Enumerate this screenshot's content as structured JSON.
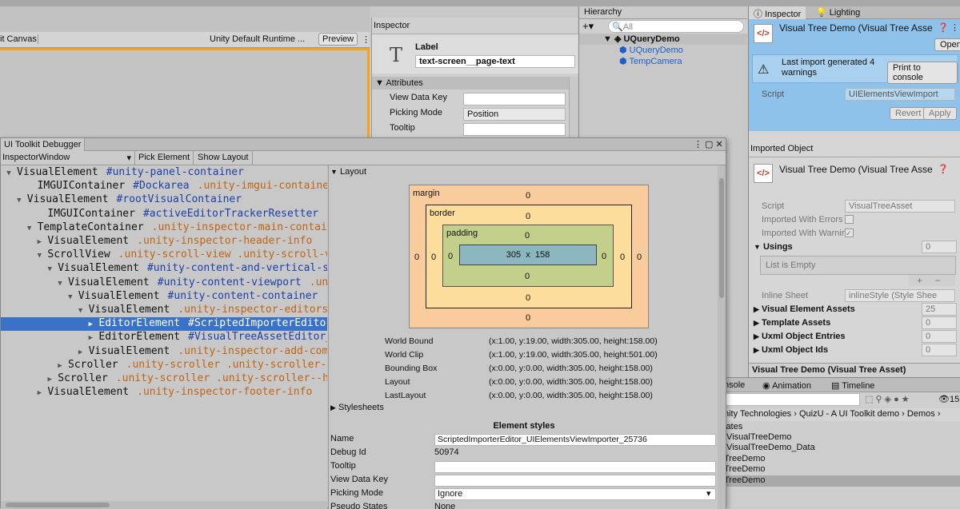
{
  "game": {
    "tab_canvas": "it Canvas",
    "runtime_select": "Unity Default Runtime ...",
    "preview_button": "Preview"
  },
  "mini_inspector": {
    "title": "Inspector",
    "label_heading": "Label",
    "label_value": "text-screen__page-text",
    "attributes_header": "Attributes",
    "rows": [
      {
        "label": "View Data Key",
        "value": ""
      },
      {
        "label": "Picking Mode",
        "value": "Position"
      },
      {
        "label": "Tooltip",
        "value": ""
      }
    ]
  },
  "hierarchy": {
    "title": "Hierarchy",
    "search_placeholder": "All",
    "root": "UQueryDemo",
    "children": [
      "UQueryDemo",
      "TempCamera"
    ]
  },
  "inspector": {
    "tab_inspector": "Inspector",
    "tab_lighting": "Lighting",
    "asset_title": "Visual Tree Demo (Visual Tree Asse",
    "open_button": "Open",
    "warning_text": "Last import generated 4 warnings",
    "print_button": "Print to console",
    "script_label": "Script",
    "script_value": "UIElementsViewImport",
    "revert_button": "Revert",
    "apply_button": "Apply",
    "imported_object": "Imported Object",
    "asset_title2": "Visual Tree Demo (Visual Tree Asse",
    "props": [
      {
        "label": "Script",
        "value": "VisualTreeAsset"
      },
      {
        "label": "Imported With Errors",
        "value": ""
      },
      {
        "label": "Imported With Warnin",
        "value": "✓"
      }
    ],
    "usings_label": "Usings",
    "usings_value": "0",
    "list_empty": "List is Empty",
    "plus": "+",
    "minus": "−",
    "inline_sheet_label": "Inline Sheet",
    "inline_sheet_value": "inlineStyle (Style Shee",
    "groups": [
      {
        "label": "Visual Element Assets",
        "value": "25"
      },
      {
        "label": "Template Assets",
        "value": "0"
      },
      {
        "label": "Uxml Object Entries",
        "value": "0"
      },
      {
        "label": "Uxml Object Ids",
        "value": "0"
      }
    ],
    "footer": "Visual Tree Demo (Visual Tree Asset)"
  },
  "console": {
    "tab_console": "nsole",
    "tab_animation": "Animation",
    "tab_timeline": "Timeline",
    "count": "15",
    "breadcrumb": [
      "nity Technologies",
      "QuizU - A UI Toolkit demo",
      "Demos"
    ],
    "items": [
      "lates",
      ".VisualTreeDemo",
      ".VisualTreeDemo_Data",
      "TreeDemo",
      "TreeDemo",
      "TreeDemo"
    ]
  },
  "debugger": {
    "title": "UI Toolkit Debugger",
    "window_select": "InspectorWindow",
    "pick_element": "Pick Element",
    "show_layout": "Show Layout",
    "tree": [
      {
        "indent": 0,
        "tri": "▼",
        "type": "VisualElement",
        "id": "#unity-panel-container",
        "cls": ""
      },
      {
        "indent": 2,
        "tri": "",
        "type": "IMGUIContainer",
        "id": "#Dockarea",
        "cls": ".unity-imgui-container"
      },
      {
        "indent": 1,
        "tri": "▼",
        "type": "VisualElement",
        "id": "#rootVisualContainer",
        "cls": ""
      },
      {
        "indent": 3,
        "tri": "",
        "type": "IMGUIContainer",
        "id": "#activeEditorTrackerResetter",
        "cls": ".uni"
      },
      {
        "indent": 2,
        "tri": "▼",
        "type": "TemplateContainer",
        "id": "",
        "cls": ".unity-inspector-main-container"
      },
      {
        "indent": 3,
        "tri": "▶",
        "type": "VisualElement",
        "id": "",
        "cls": ".unity-inspector-header-info"
      },
      {
        "indent": 3,
        "tri": "▼",
        "type": "ScrollView",
        "id": "",
        "cls": ".unity-scroll-view  .unity-scroll-vie"
      },
      {
        "indent": 4,
        "tri": "▼",
        "type": "VisualElement",
        "id": "#unity-content-and-vertical-scro",
        "cls": ""
      },
      {
        "indent": 5,
        "tri": "▼",
        "type": "VisualElement",
        "id": "#unity-content-viewport",
        "cls": ".unit"
      },
      {
        "indent": 6,
        "tri": "▼",
        "type": "VisualElement",
        "id": "#unity-content-container",
        "cls": ".u"
      },
      {
        "indent": 7,
        "tri": "▼",
        "type": "VisualElement",
        "id": "",
        "cls": ".unity-inspector-editors-li"
      },
      {
        "indent": 8,
        "tri": "▶",
        "type": "EditorElement",
        "id": "#ScriptedImporterEditor_U",
        "cls": "",
        "selected": true
      },
      {
        "indent": 8,
        "tri": "▶",
        "type": "EditorElement",
        "id": "#VisualTreeAssetEditor_Vi",
        "cls": ""
      },
      {
        "indent": 7,
        "tri": "▶",
        "type": "VisualElement",
        "id": "",
        "cls": ".unity-inspector-add-compon"
      },
      {
        "indent": 5,
        "tri": "▶",
        "type": "Scroller",
        "id": "",
        "cls": ".unity-scroller  .unity-scroller--v"
      },
      {
        "indent": 4,
        "tri": "▶",
        "type": "Scroller",
        "id": "",
        "cls": ".unity-scroller  .unity-scroller--hor"
      },
      {
        "indent": 3,
        "tri": "▶",
        "type": "VisualElement",
        "id": "",
        "cls": ".unity-inspector-footer-info"
      }
    ],
    "layout_header": "Layout",
    "box": {
      "margin_label": "margin",
      "border_label": "border",
      "padding_label": "padding",
      "zero": "0",
      "width": "305",
      "x": "x",
      "height": "158"
    },
    "bounds": [
      {
        "label": "World Bound",
        "value": "(x:1.00, y:19.00, width:305.00, height:158.00)"
      },
      {
        "label": "World Clip",
        "value": "(x:1.00, y:19.00, width:305.00, height:501.00)"
      },
      {
        "label": "Bounding Box",
        "value": "(x:0.00, y:0.00, width:305.00, height:158.00)"
      },
      {
        "label": "Layout",
        "value": "(x:0.00, y:0.00, width:305.00, height:158.00)"
      },
      {
        "label": "LastLayout",
        "value": "(x:0.00, y:0.00, width:305.00, height:158.00)"
      }
    ],
    "stylesheets_header": "Stylesheets",
    "element_styles": "Element styles",
    "styles": [
      {
        "label": "Name",
        "value": "ScriptedImporterEditor_UIElementsViewImporter_25736",
        "kind": "field"
      },
      {
        "label": "Debug Id",
        "value": "50974",
        "kind": "text"
      },
      {
        "label": "Tooltip",
        "value": "",
        "kind": "field"
      },
      {
        "label": "View Data Key",
        "value": "",
        "kind": "field"
      },
      {
        "label": "Picking Mode",
        "value": "Ignore",
        "kind": "select"
      },
      {
        "label": "Pseudo States",
        "value": "None",
        "kind": "text"
      }
    ]
  },
  "colors": {
    "selection": "#3a72c8",
    "inspector_highlight": "#8fc2ea",
    "margin": "#f9cc9d",
    "border": "#fddd9b",
    "padding": "#c3d08b",
    "content": "#8cb6c0",
    "accent_orange": "#f4a31b"
  }
}
